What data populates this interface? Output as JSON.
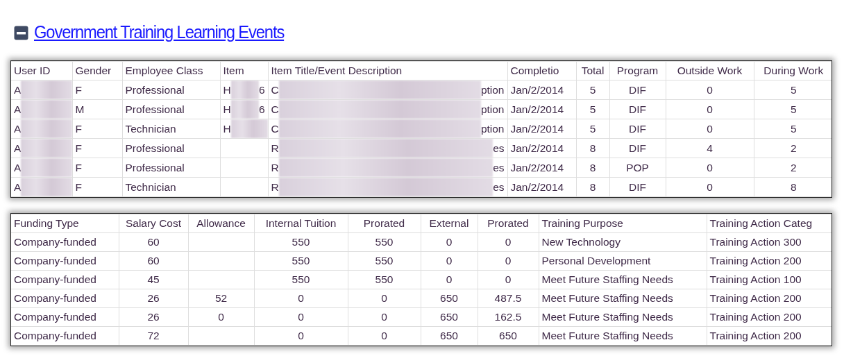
{
  "section": {
    "title": "Government Training Learning Events",
    "expanded": true
  },
  "tables": [
    {
      "columns": [
        {
          "label": "User ID",
          "kind": "text"
        },
        {
          "label": "Gender",
          "kind": "text"
        },
        {
          "label": "Employee Class",
          "kind": "text"
        },
        {
          "label": "Item",
          "kind": "text"
        },
        {
          "label": "Item Title/Event Description",
          "kind": "text"
        },
        {
          "label": "Completio",
          "kind": "text"
        },
        {
          "label": "Total",
          "kind": "number"
        },
        {
          "label": "Program",
          "kind": "number"
        },
        {
          "label": "Outside Work",
          "kind": "number"
        },
        {
          "label": "During Work",
          "kind": "number"
        }
      ],
      "rows": [
        [
          {
            "text": "A",
            "redacted": true
          },
          {
            "text": "F"
          },
          {
            "text": "Professional"
          },
          {
            "text": "H",
            "end": "6",
            "redacted": true
          },
          {
            "text": "C",
            "end": "ption",
            "redacted": true
          },
          {
            "text": "Jan/2/2014"
          },
          {
            "text": "5"
          },
          {
            "text": "DIF"
          },
          {
            "text": "0"
          },
          {
            "text": "5"
          }
        ],
        [
          {
            "text": "A",
            "redacted": true
          },
          {
            "text": "M"
          },
          {
            "text": "Professional"
          },
          {
            "text": "H",
            "end": "6",
            "redacted": true
          },
          {
            "text": "C",
            "end": "ption",
            "redacted": true
          },
          {
            "text": "Jan/2/2014"
          },
          {
            "text": "5"
          },
          {
            "text": "DIF"
          },
          {
            "text": "0"
          },
          {
            "text": "5"
          }
        ],
        [
          {
            "text": "A",
            "redacted": true
          },
          {
            "text": "F"
          },
          {
            "text": "Technician"
          },
          {
            "text": "H",
            "redacted": true
          },
          {
            "text": "C",
            "end": "ption",
            "redacted": true
          },
          {
            "text": "Jan/2/2014"
          },
          {
            "text": "5"
          },
          {
            "text": "DIF"
          },
          {
            "text": "0"
          },
          {
            "text": "5"
          }
        ],
        [
          {
            "text": "A",
            "redacted": true
          },
          {
            "text": "F"
          },
          {
            "text": "Professional"
          },
          {},
          {
            "text": "R",
            "end": "es",
            "redacted": true
          },
          {
            "text": "Jan/2/2014"
          },
          {
            "text": "8"
          },
          {
            "text": "DIF"
          },
          {
            "text": "4"
          },
          {
            "text": "2"
          }
        ],
        [
          {
            "text": "A",
            "redacted": true
          },
          {
            "text": "F"
          },
          {
            "text": "Professional"
          },
          {},
          {
            "text": "R",
            "end": "es",
            "redacted": true
          },
          {
            "text": "Jan/2/2014"
          },
          {
            "text": "8"
          },
          {
            "text": "POP"
          },
          {
            "text": "0"
          },
          {
            "text": "2"
          }
        ],
        [
          {
            "text": "A",
            "redacted": true
          },
          {
            "text": "F"
          },
          {
            "text": "Technician"
          },
          {},
          {
            "text": "R",
            "end": "es",
            "redacted": true
          },
          {
            "text": "Jan/2/2014"
          },
          {
            "text": "8"
          },
          {
            "text": "DIF"
          },
          {
            "text": "0"
          },
          {
            "text": "8"
          }
        ]
      ]
    },
    {
      "columns": [
        {
          "label": "Funding Type",
          "kind": "text"
        },
        {
          "label": "Salary Cost",
          "kind": "number"
        },
        {
          "label": "Allowance",
          "kind": "number"
        },
        {
          "label": "Internal Tuition",
          "kind": "number"
        },
        {
          "label": "Prorated",
          "kind": "number"
        },
        {
          "label": "External",
          "kind": "number"
        },
        {
          "label": "Prorated",
          "kind": "number"
        },
        {
          "label": "Training Purpose",
          "kind": "text"
        },
        {
          "label": "Training Action Categ",
          "kind": "text"
        }
      ],
      "rows": [
        [
          {
            "text": "Company-funded"
          },
          {
            "text": "60"
          },
          {},
          {
            "text": "550"
          },
          {
            "text": "550"
          },
          {
            "text": "0"
          },
          {
            "text": "0"
          },
          {
            "text": "New Technology"
          },
          {
            "text": "Training Action 300"
          }
        ],
        [
          {
            "text": "Company-funded"
          },
          {
            "text": "60"
          },
          {},
          {
            "text": "550"
          },
          {
            "text": "550"
          },
          {
            "text": "0"
          },
          {
            "text": "0"
          },
          {
            "text": "Personal Development"
          },
          {
            "text": "Training Action 200"
          }
        ],
        [
          {
            "text": "Company-funded"
          },
          {
            "text": "45"
          },
          {},
          {
            "text": "550"
          },
          {
            "text": "550"
          },
          {
            "text": "0"
          },
          {
            "text": "0"
          },
          {
            "text": "Meet Future Staffing Needs"
          },
          {
            "text": "Training Action 100"
          }
        ],
        [
          {
            "text": "Company-funded"
          },
          {
            "text": "26"
          },
          {
            "text": "52"
          },
          {
            "text": "0"
          },
          {
            "text": "0"
          },
          {
            "text": "650"
          },
          {
            "text": "487.5"
          },
          {
            "text": "Meet Future Staffing Needs"
          },
          {
            "text": "Training Action 200"
          }
        ],
        [
          {
            "text": "Company-funded"
          },
          {
            "text": "26"
          },
          {
            "text": "0"
          },
          {
            "text": "0"
          },
          {
            "text": "0"
          },
          {
            "text": "650"
          },
          {
            "text": "162.5"
          },
          {
            "text": "Meet Future Staffing Needs"
          },
          {
            "text": "Training Action 200"
          }
        ],
        [
          {
            "text": "Company-funded"
          },
          {
            "text": "72"
          },
          {},
          {
            "text": "0"
          },
          {
            "text": "0"
          },
          {
            "text": "650"
          },
          {
            "text": "650"
          },
          {
            "text": "Meet Future Staffing Needs"
          },
          {
            "text": "Training Action 200"
          }
        ]
      ]
    }
  ]
}
